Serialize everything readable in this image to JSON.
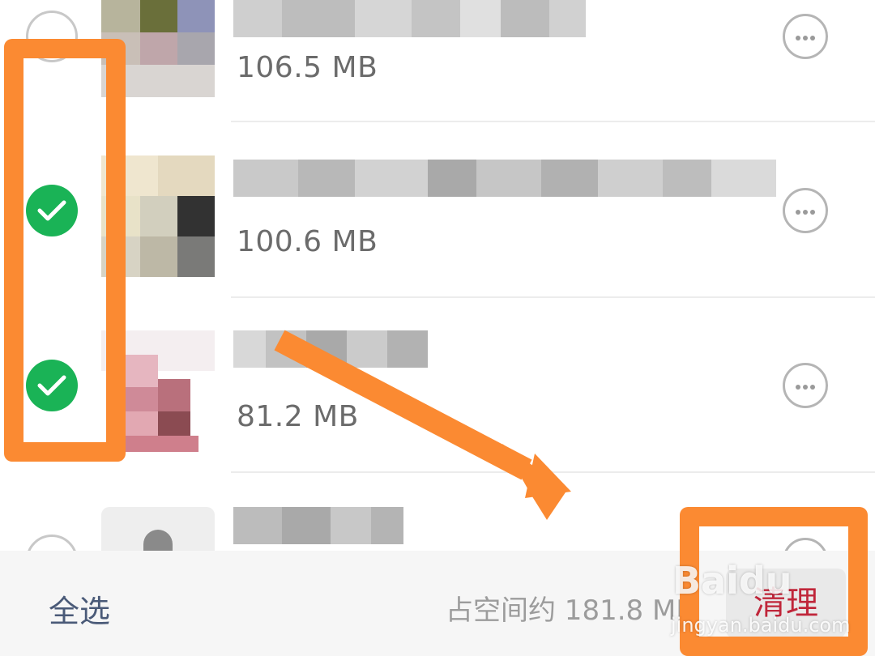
{
  "files": [
    {
      "size": "106.5 MB",
      "checked": false
    },
    {
      "size": "100.6 MB",
      "checked": true
    },
    {
      "size": "81.2 MB",
      "checked": true
    },
    {
      "size": "",
      "checked": false
    }
  ],
  "bottom_bar": {
    "select_all_label": "全选",
    "space_info": "占空间约 181.8 MB",
    "clean_label": "清理"
  },
  "watermark": {
    "text": "Baidu",
    "sub": "jingyan.baidu.com"
  },
  "icons": {
    "check": "check-icon",
    "more": "more-icon",
    "arrow": "arrow-annotation"
  },
  "colors": {
    "checked_green": "#1ab356",
    "annotation_orange": "#fb8a32",
    "clean_text": "#c0263a",
    "select_all_text": "#4a5a78"
  }
}
